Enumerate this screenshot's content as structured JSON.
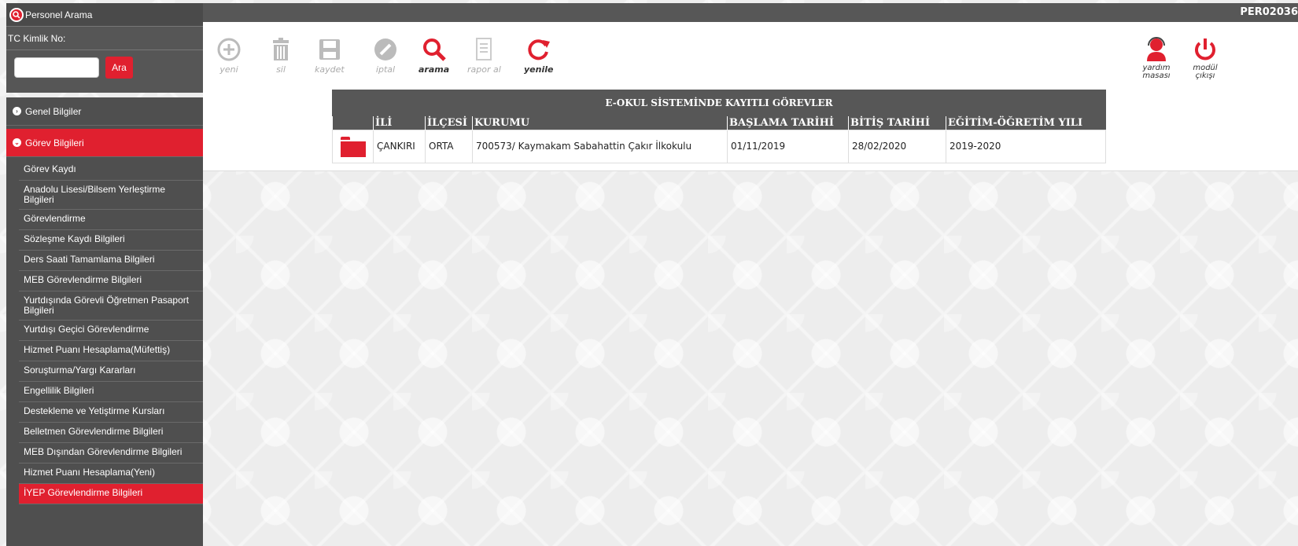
{
  "search": {
    "title": "Personel Arama",
    "tc_label": "TC Kimlik No:",
    "tc_value": "",
    "button": "Ara"
  },
  "menu": {
    "general": "Genel Bilgiler",
    "duty": "Görev Bilgileri",
    "items": [
      "Görev Kaydı",
      "Anadolu Lisesi/Bilsem Yerleştirme Bilgileri",
      "Görevlendirme",
      "Sözleşme Kaydı Bilgileri",
      "Ders Saati Tamamlama Bilgileri",
      "MEB Görevlendirme Bilgileri",
      "Yurtdışında Görevli Öğretmen Pasaport Bilgileri",
      "Yurtdışı Geçici Görevlendirme",
      "Hizmet Puanı Hesaplama(Müfettiş)",
      "Soruşturma/Yargı Kararları",
      "Engellilik Bilgileri",
      "Destekleme ve Yetiştirme Kursları",
      "Belletmen Görevlendirme Bilgileri",
      "MEB Dışından Görevlendirme Bilgileri",
      "Hizmet Puanı Hesaplama(Yeni)",
      "İYEP Görevlendirme Bilgileri"
    ]
  },
  "header": {
    "code": "PER02036"
  },
  "toolbar": {
    "yeni": "yeni",
    "sil": "sil",
    "kaydet": "kaydet",
    "iptal": "iptal",
    "arama": "arama",
    "rapor": "rapor al",
    "yenile": "yenile",
    "yardim": "yardım masası",
    "modul": "modül çıkışı"
  },
  "colors": {
    "accent": "#e0202f",
    "dark": "#575757"
  },
  "table": {
    "caption": "E-OKUL SİSTEMİNDE KAYITLI GÖREVLER",
    "headers": [
      "",
      "İLİ",
      "İLÇESİ",
      "KURUMU",
      "BAŞLAMA TARİHİ",
      "BİTİŞ TARİHİ",
      "EĞİTİM-ÖĞRETİM YILI"
    ],
    "row": {
      "il": "ÇANKIRI",
      "ilce": "ORTA",
      "kurum": "700573/ Kaymakam Sabahattin Çakır İlkokulu",
      "baslama": "01/11/2019",
      "bitis": "28/02/2020",
      "yil": "2019-2020"
    }
  }
}
